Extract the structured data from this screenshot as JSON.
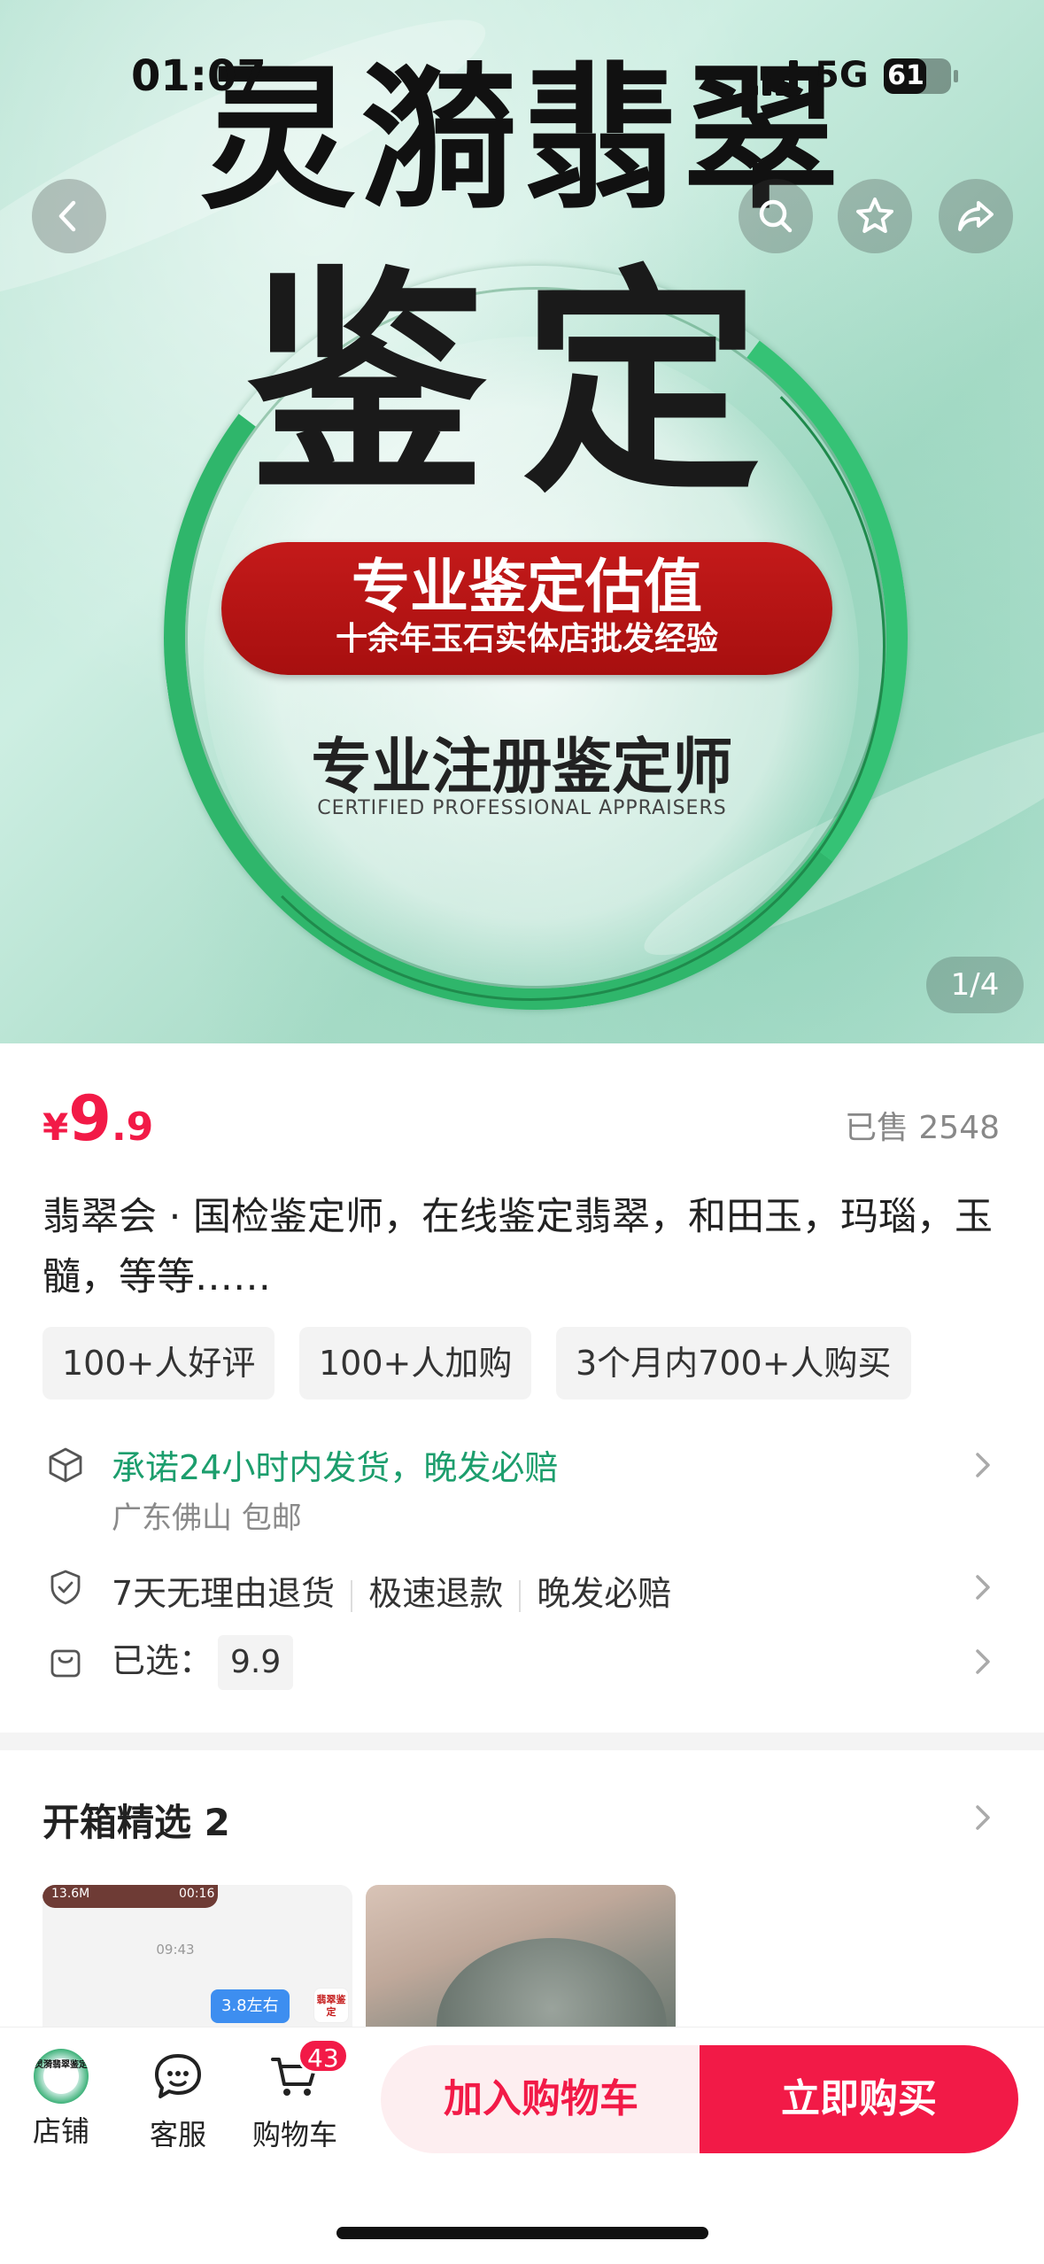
{
  "status_bar": {
    "time": "01:07",
    "network": "5G",
    "battery": "61"
  },
  "hero": {
    "title_line1": "灵漪翡翠",
    "title_line2": "鉴定",
    "banner_main": "专业鉴定估值",
    "banner_sub": "十余年玉石实体店批发经验",
    "subtitle": "专业注册鉴定师",
    "subtitle_en": "CERTIFIED PROFESSIONAL APPRAISERS",
    "pager": "1/4"
  },
  "product": {
    "currency": "¥",
    "price_int": "9",
    "price_dec": ".9",
    "sold": "已售 2548",
    "title": "翡翠会 · 国检鉴定师，在线鉴定翡翠，和田玉，玛瑙，玉髓，等等……",
    "tags": [
      "100+人好评",
      "100+人加购",
      "3个月内700+人购买"
    ]
  },
  "shipping": {
    "promise": "承诺24小时内发货，晚发必赔",
    "origin": "广东佛山 包邮"
  },
  "service": {
    "items": [
      "7天无理由退货",
      "极速退款",
      "晚发必赔"
    ]
  },
  "selection": {
    "label": "已选：",
    "value": "9.9"
  },
  "unboxing": {
    "title": "开箱精选 2",
    "thumb1": {
      "size": "13.6M",
      "duration": "00:16",
      "time": "09:43",
      "bubble": "3.8左右",
      "logo": "翡翠鉴定"
    }
  },
  "bottom_bar": {
    "shop": "店铺",
    "service": "客服",
    "cart": "购物车",
    "cart_count": "43",
    "shop_logo_text": "灵漪翡翠鉴定",
    "add_to_cart": "加入购物车",
    "buy_now": "立即购买"
  },
  "colors": {
    "accent": "#f21a47",
    "green": "#1c9e6d",
    "ring": "#2fb66b",
    "banner_red": "#c41a1a"
  }
}
